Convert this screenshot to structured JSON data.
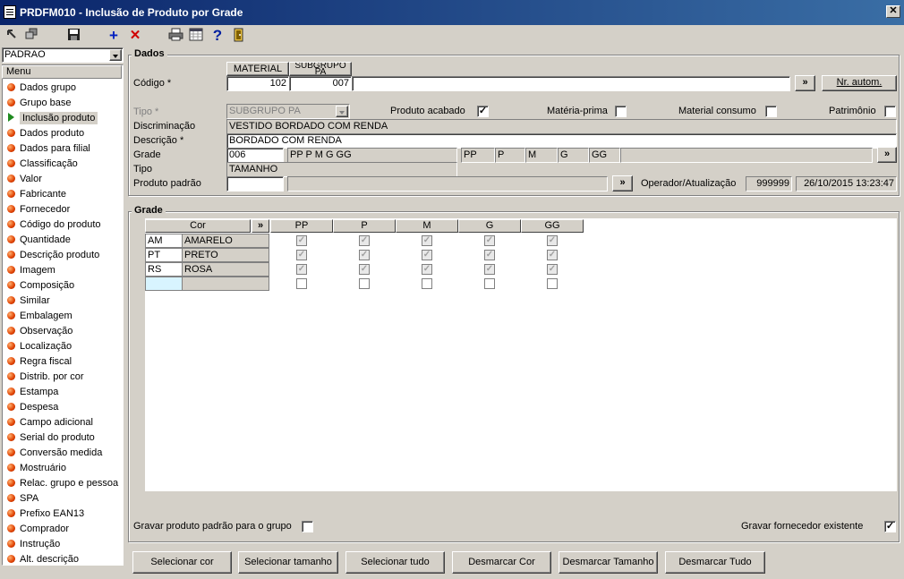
{
  "window": {
    "title": "PRDFM010 - Inclusão de Produto por Grade",
    "close_glyph": "✕"
  },
  "toolbar": {
    "icons": [
      "nav-back-icon",
      "nav-multi-icon",
      "save-icon",
      "add-icon",
      "delete-icon",
      "print-icon",
      "calendar-icon",
      "help-icon",
      "exit-door-icon"
    ]
  },
  "profile": {
    "value": "PADRAO"
  },
  "menu": {
    "header": "Menu",
    "items": [
      "Dados grupo",
      "Grupo base",
      "Inclusão produto",
      "Dados produto",
      "Dados para filial",
      "Classificação",
      "Valor",
      "Fabricante",
      "Fornecedor",
      "Código do produto",
      "Quantidade",
      "Descrição produto",
      "Imagem",
      "Composição",
      "Similar",
      "Embalagem",
      "Observação",
      "Localização",
      "Regra fiscal",
      "Distrib. por cor",
      "Estampa",
      "Despesa",
      "Campo adicional",
      "Serial do produto",
      "Conversão medida",
      "Mostruário",
      "Relac. grupo e pessoa",
      "SPA",
      "Prefixo EAN13",
      "Comprador",
      "Instrução",
      "Alt. descrição"
    ],
    "selected_index": 2
  },
  "dados": {
    "title": "Dados",
    "col_material": "MATERIAL",
    "col_subgrupo": "SUBGRUPO PA",
    "codigo_label": "Código *",
    "codigo_material": "102",
    "codigo_subgrupo": "007",
    "expand_glyph": "»",
    "nr_autom_button": "Nr. autom.",
    "tipo_label": "Tipo *",
    "tipo_value": "SUBGRUPO PA",
    "produto_acabado_label": "Produto acabado",
    "materia_prima_label": "Matéria-prima",
    "material_consumo_label": "Material consumo",
    "patrimonio_label": "Patrimônio",
    "check_mark": "✓",
    "produto_acabado": true,
    "materia_prima": false,
    "material_consumo": false,
    "patrimonio": false,
    "discriminacao_label": "Discriminação",
    "discriminacao_value": "VESTIDO BORDADO COM RENDA",
    "descricao_label": "Descrição *",
    "descricao_value": "BORDADO COM RENDA",
    "grade_label": "Grade",
    "grade_code": "006",
    "grade_desc": "PP P M G GG",
    "grade_sizes": [
      "PP",
      "P",
      "M",
      "G",
      "GG"
    ],
    "tipo2_label": "Tipo",
    "tipo2_value": "TAMANHO",
    "produto_padrao_label": "Produto padrão",
    "produto_padrao_value": "",
    "operador_label": "Operador/Atualização",
    "operador_value": "999999",
    "atualizacao_value": "26/10/2015 13:23:47"
  },
  "grade": {
    "title": "Grade",
    "cor_header": "Cor",
    "sizes": [
      "PP",
      "P",
      "M",
      "G",
      "GG"
    ],
    "rows": [
      {
        "code": "AM",
        "name": "AMARELO",
        "checked": [
          true,
          true,
          true,
          true,
          true
        ]
      },
      {
        "code": "PT",
        "name": "PRETO",
        "checked": [
          true,
          true,
          true,
          true,
          true
        ]
      },
      {
        "code": "RS",
        "name": "ROSA",
        "checked": [
          true,
          true,
          true,
          true,
          true
        ]
      },
      {
        "code": "",
        "name": "",
        "checked": [
          false,
          false,
          false,
          false,
          false
        ]
      }
    ]
  },
  "options": {
    "gravar_padrao_label": "Gravar produto padrão para o grupo",
    "gravar_padrao": false,
    "gravar_fornecedor_label": "Gravar fornecedor existente",
    "gravar_fornecedor": true
  },
  "buttons": {
    "selecionar_cor": "Selecionar cor",
    "selecionar_tamanho": "Selecionar tamanho",
    "selecionar_tudo": "Selecionar tudo",
    "desmarcar_cor": "Desmarcar Cor",
    "desmarcar_tamanho": "Desmarcar Tamanho",
    "desmarcar_tudo": "Desmarcar Tudo"
  }
}
